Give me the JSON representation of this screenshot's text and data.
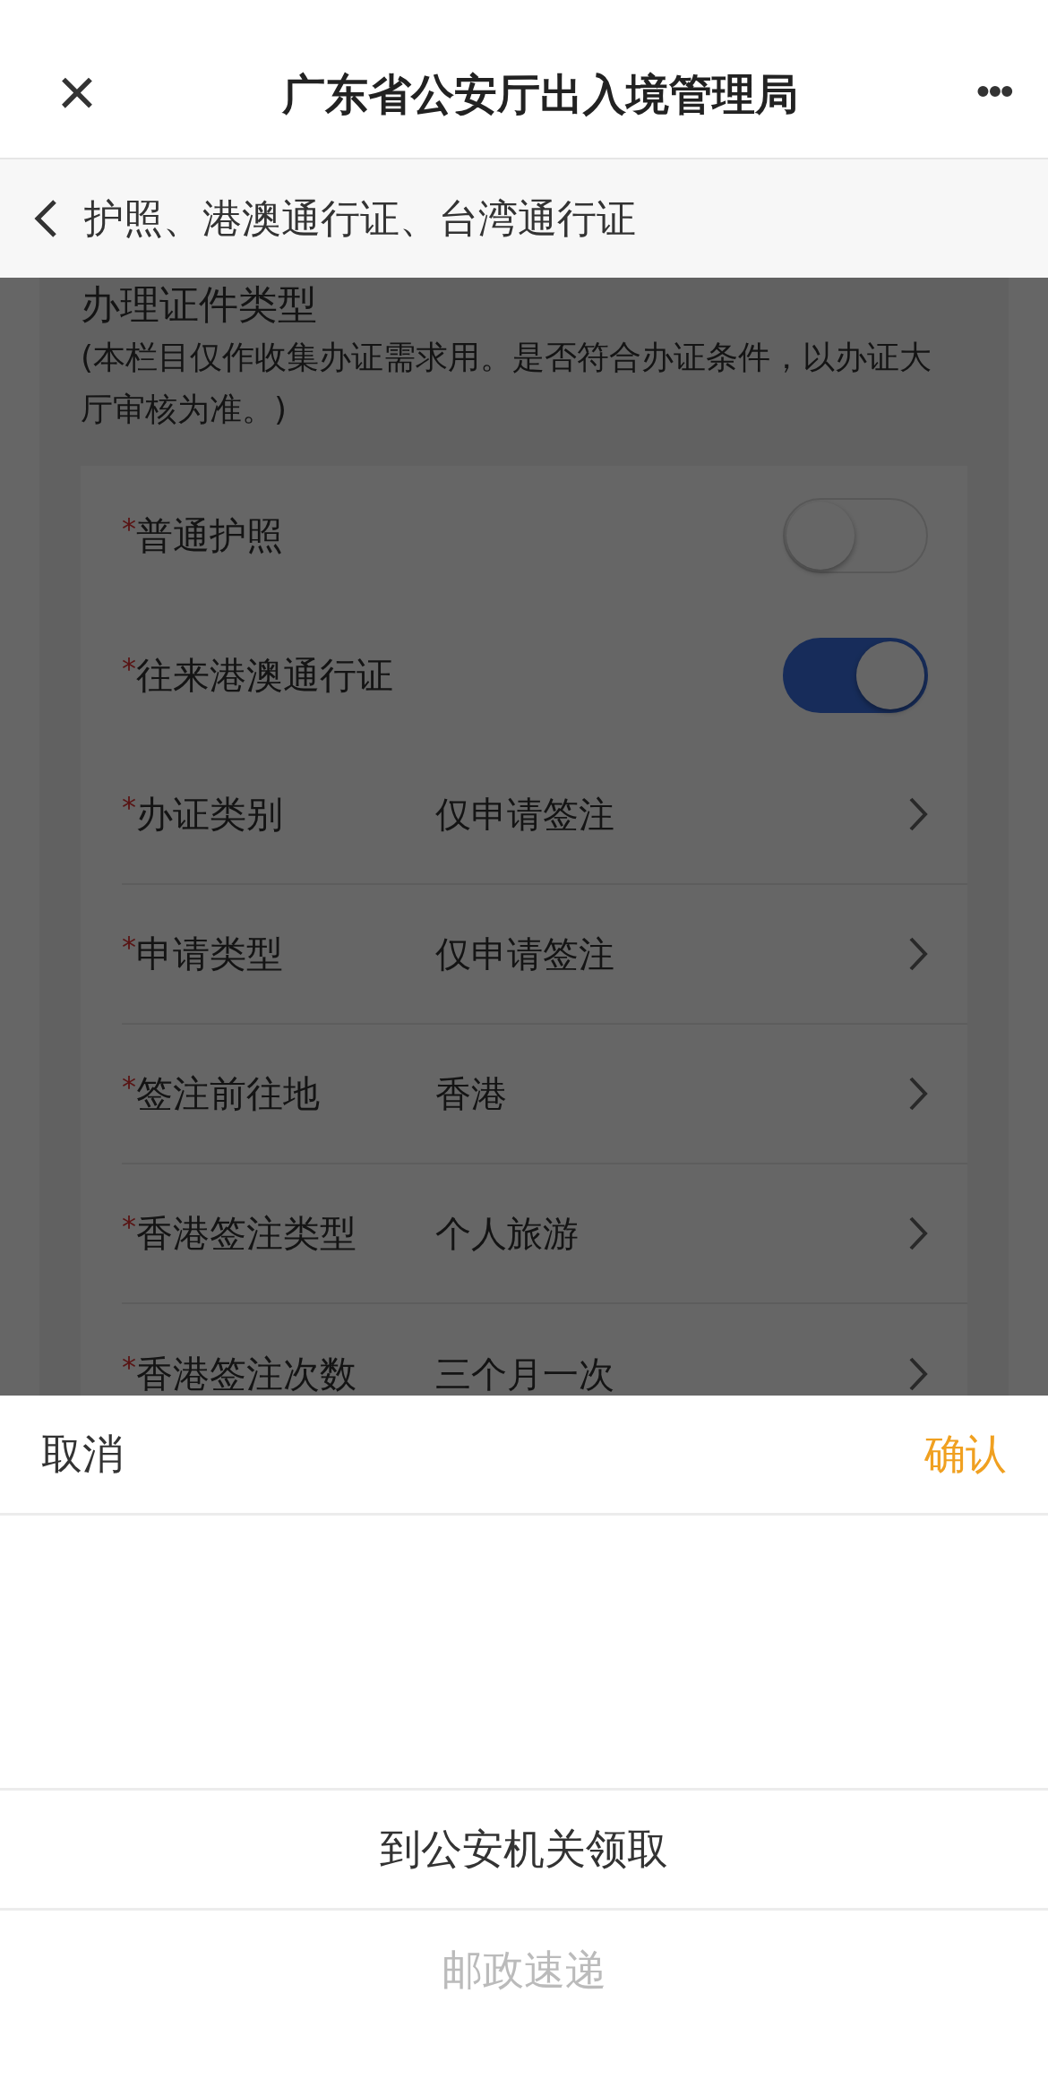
{
  "header": {
    "close": "×",
    "title": "广东省公安厅出入境管理局",
    "more": "•••"
  },
  "subnav": {
    "title": "护照、港澳通行证、台湾通行证"
  },
  "section": {
    "heading": "办理证件类型",
    "note": "(本栏目仅作收集办证需求用。是否符合办证条件，以办证大厅审核为准。)"
  },
  "rows": [
    {
      "kind": "toggle",
      "mark": "*",
      "label": "普通护照",
      "on": false
    },
    {
      "kind": "toggle",
      "mark": "*",
      "label": "往来港澳通行证",
      "on": true
    },
    {
      "kind": "select",
      "mark": "*",
      "label": "办证类别",
      "value": "仅申请签注"
    },
    {
      "kind": "select",
      "mark": "*",
      "label": "申请类型",
      "value": "仅申请签注"
    },
    {
      "kind": "select",
      "mark": "*",
      "label": "签注前往地",
      "value": "香港"
    },
    {
      "kind": "select",
      "mark": "*",
      "label": "香港签注类型",
      "value": "个人旅游"
    },
    {
      "kind": "select",
      "mark": "*",
      "label": "香港签注次数",
      "value": "三个月一次"
    }
  ],
  "picker": {
    "cancel": "取消",
    "confirm": "确认",
    "options": [
      {
        "label": "到公安机关领取",
        "selected": true
      },
      {
        "label": "邮政速递",
        "selected": false
      }
    ]
  }
}
